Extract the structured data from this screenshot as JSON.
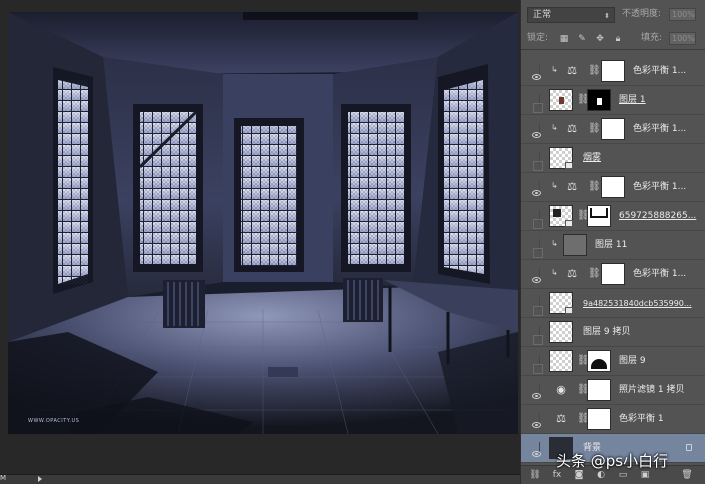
{
  "document": {
    "watermark": "WWW.OPACITY.US"
  },
  "status": {
    "zoom": "M"
  },
  "layers_panel": {
    "blend_mode": "正常",
    "opacity_label": "不透明度:",
    "opacity_value": "100%",
    "lock_label": "锁定:",
    "fill_label": "填充:",
    "fill_value": "100%",
    "layers": [
      {
        "name": "色彩平衡 1...",
        "visible": true
      },
      {
        "name": "图层 1",
        "visible": false
      },
      {
        "name": "色彩平衡 1...",
        "visible": true
      },
      {
        "name": "烟雾",
        "visible": false
      },
      {
        "name": "色彩平衡 1...",
        "visible": true
      },
      {
        "name": "659725888265...",
        "visible": false
      },
      {
        "name": "图层 11",
        "visible": false
      },
      {
        "name": "色彩平衡 1...",
        "visible": true
      },
      {
        "name": "9a482531840dcb535990...",
        "visible": false
      },
      {
        "name": "图层 9 拷贝",
        "visible": false
      },
      {
        "name": "图层 9",
        "visible": false
      },
      {
        "name": "照片滤镜 1 拷贝",
        "visible": true
      },
      {
        "name": "色彩平衡 1",
        "visible": true
      },
      {
        "name": "背景",
        "visible": true
      }
    ]
  },
  "watermark": {
    "text": "头条 @ps小白行"
  }
}
